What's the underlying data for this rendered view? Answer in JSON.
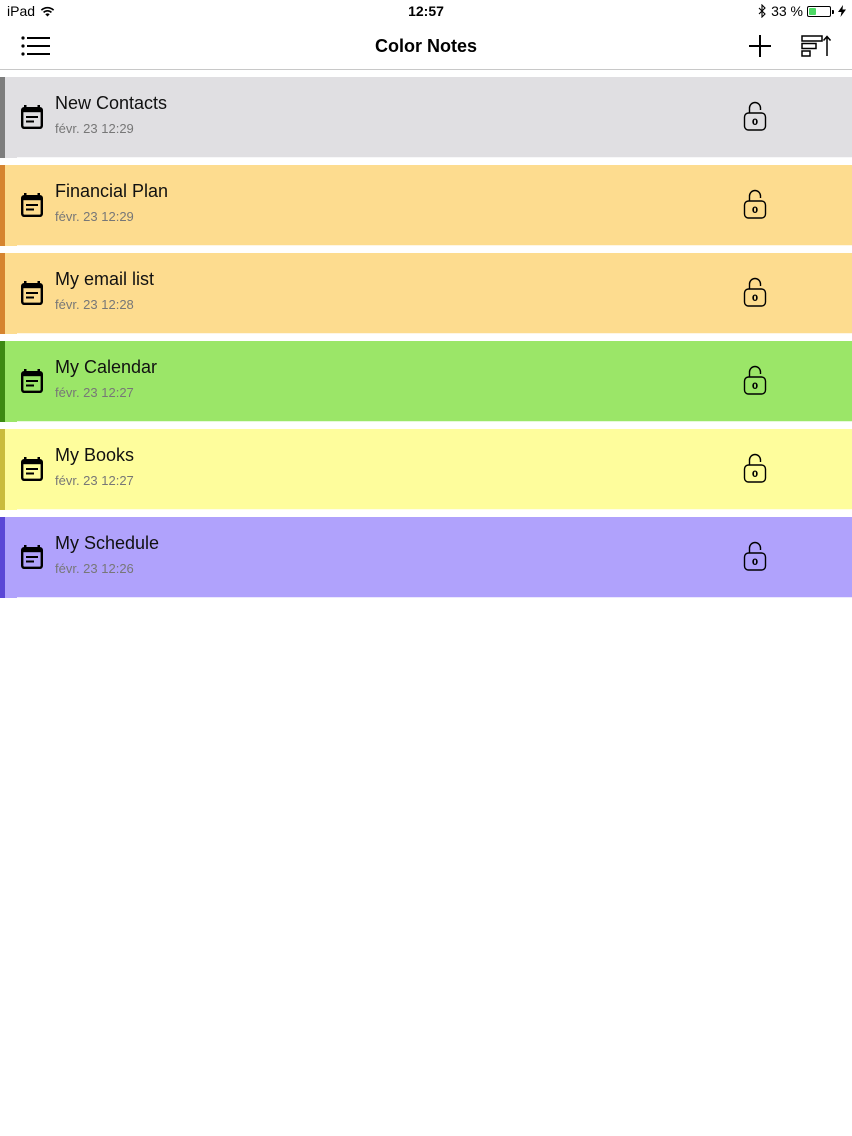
{
  "status_bar": {
    "device": "iPad",
    "time": "12:57",
    "battery_percent": "33 %",
    "battery_level": 0.33
  },
  "header": {
    "title": "Color Notes"
  },
  "notes": [
    {
      "title": "New Contacts",
      "date": "févr. 23  12:29",
      "lock_count": "0",
      "bg": "#e0dfe2",
      "accent": "#7d7d7d"
    },
    {
      "title": "Financial Plan",
      "date": "févr. 23  12:29",
      "lock_count": "0",
      "bg": "#fddc8f",
      "accent": "#d6842f"
    },
    {
      "title": "My email list",
      "date": "févr. 23  12:28",
      "lock_count": "0",
      "bg": "#fddc8f",
      "accent": "#d6842f"
    },
    {
      "title": "My Calendar",
      "date": "févr. 23  12:27",
      "lock_count": "0",
      "bg": "#9be668",
      "accent": "#3d8a12"
    },
    {
      "title": "My Books",
      "date": "févr. 23  12:27",
      "lock_count": "0",
      "bg": "#fefd9c",
      "accent": "#c9bc3c"
    },
    {
      "title": "My Schedule",
      "date": "févr. 23  12:26",
      "lock_count": "0",
      "bg": "#b0a2fc",
      "accent": "#5a47d6"
    }
  ],
  "icons": {
    "menu": "list-icon",
    "add": "plus-icon",
    "sort": "sort-icon",
    "note": "note-icon",
    "lock": "lock-icon",
    "wifi": "wifi-icon",
    "bluetooth": "bluetooth-icon",
    "battery": "battery-icon",
    "charging": "charging-icon"
  }
}
